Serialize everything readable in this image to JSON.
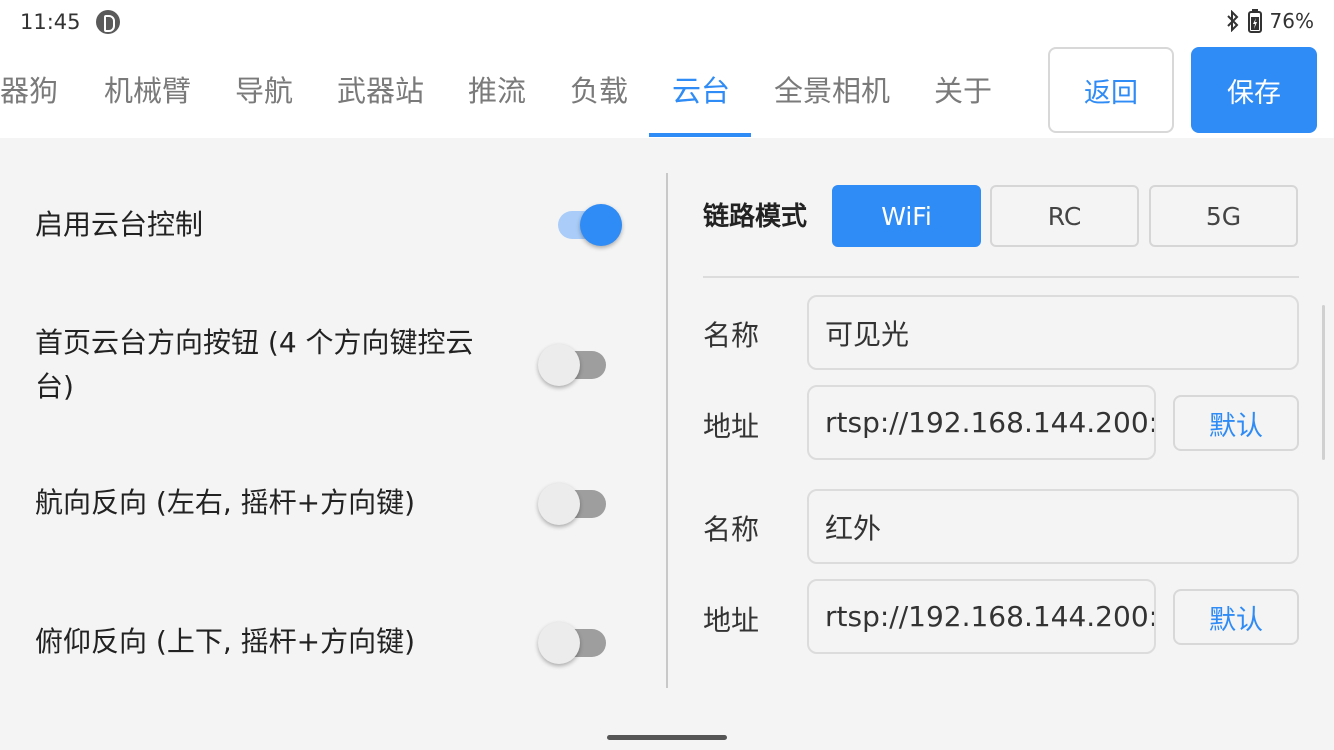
{
  "status": {
    "time": "11:45",
    "battery": "76%"
  },
  "tabs": [
    {
      "label": "器狗",
      "active": false
    },
    {
      "label": "机械臂",
      "active": false
    },
    {
      "label": "导航",
      "active": false
    },
    {
      "label": "武器站",
      "active": false
    },
    {
      "label": "推流",
      "active": false
    },
    {
      "label": "负载",
      "active": false
    },
    {
      "label": "云台",
      "active": true
    },
    {
      "label": "全景相机",
      "active": false
    },
    {
      "label": "关于",
      "active": false
    }
  ],
  "actions": {
    "back_label": "返回",
    "save_label": "保存"
  },
  "settings": [
    {
      "label": "启用云台控制",
      "enabled": true
    },
    {
      "label_line1": "首页云台方向按钮 (4 个方向键控云",
      "label_line2": "台)",
      "enabled": false
    },
    {
      "label": "航向反向 (左右, 摇杆+方向键)",
      "enabled": false
    },
    {
      "label": "俯仰反向 (上下, 摇杆+方向键)",
      "enabled": false
    }
  ],
  "link_mode": {
    "label": "链路模式",
    "options": [
      "WiFi",
      "RC",
      "5G"
    ],
    "selected": "WiFi"
  },
  "streams": [
    {
      "name_label": "名称",
      "name_value": "可见光",
      "address_label": "地址",
      "address_value": "rtsp://192.168.144.200:",
      "default_label": "默认"
    },
    {
      "name_label": "名称",
      "name_value": "红外",
      "address_label": "地址",
      "address_value": "rtsp://192.168.144.200:",
      "default_label": "默认"
    }
  ],
  "colors": {
    "accent": "#2f8bf5",
    "background": "#f4f4f4"
  }
}
